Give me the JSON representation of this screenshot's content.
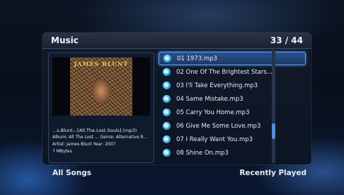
{
  "header": {
    "title": "Music",
    "counter": "33 / 44"
  },
  "now_playing": {
    "album_art_text": "JAMES BLUNT",
    "filename": "...s.Blunt.-.[All.The.Lost.Souls].(mp3)",
    "album_line": "Album: All The Lost ...  Genre: Alternative R...",
    "artist_line": "Artist: James Blunt    Year: 2007",
    "size": "7 MBytes"
  },
  "tracks": [
    {
      "label": "01 1973.mp3",
      "selected": true
    },
    {
      "label": "02 One Of The Brightest Stars....",
      "selected": false
    },
    {
      "label": "03 I'll Take Everything.mp3",
      "selected": false
    },
    {
      "label": "04 Same Mistake.mp3",
      "selected": false
    },
    {
      "label": "05 Carry You Home.mp3",
      "selected": false
    },
    {
      "label": "06 Give Me Some Love.mp3",
      "selected": false
    },
    {
      "label": "07 I Really Want You.mp3",
      "selected": false
    },
    {
      "label": "08 Shine On.mp3",
      "selected": false
    }
  ],
  "scroll": {
    "position": 0.75
  },
  "footer": {
    "left_label": "All Songs",
    "right_label": "Recently Played"
  },
  "colors": {
    "accent": "#5fa3ff",
    "selection": "#2b4f8a",
    "icon": "#3ab4e6"
  },
  "icons": {
    "track": "music-file-icon"
  }
}
